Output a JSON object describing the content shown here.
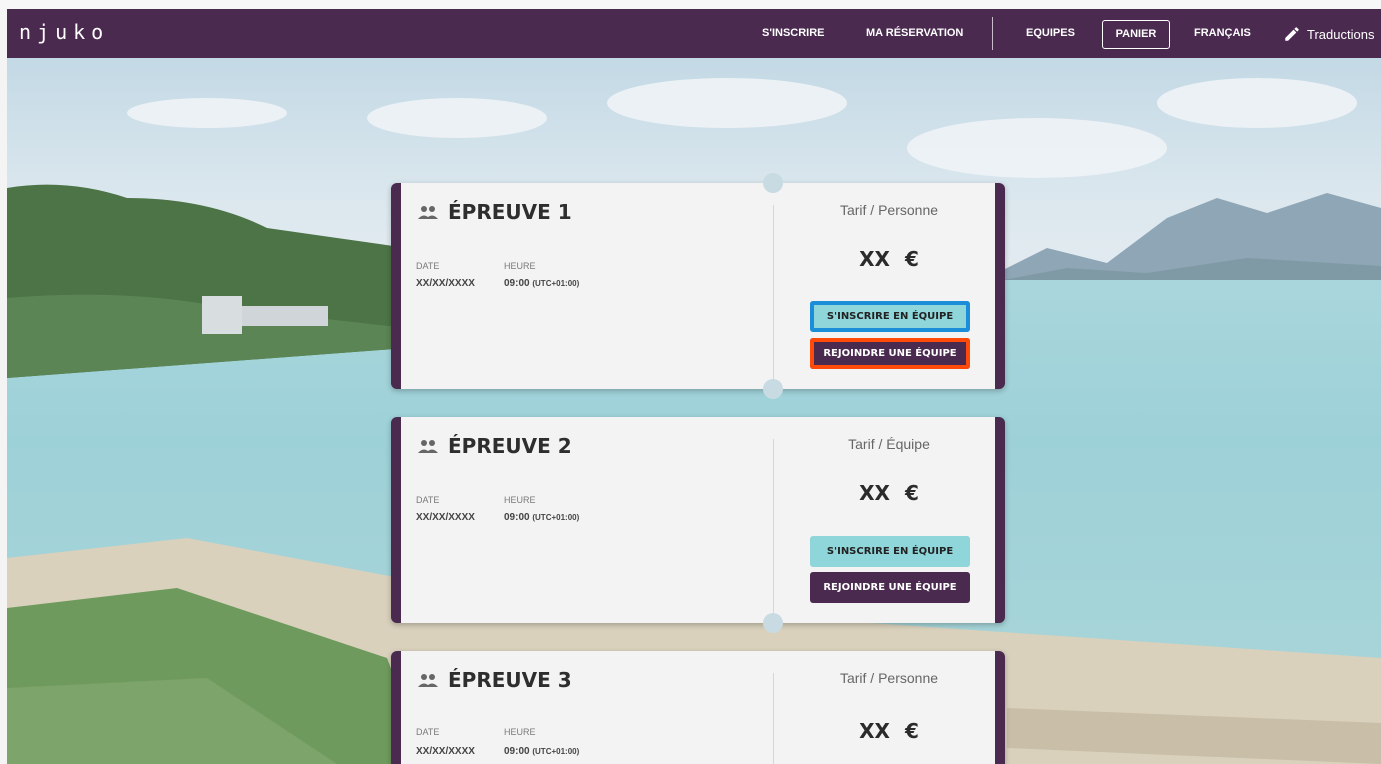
{
  "app": {
    "logo": "njuko"
  },
  "nav": {
    "register": "S'INSCRIRE",
    "my_booking": "MA RÉSERVATION",
    "teams": "EQUIPES",
    "cart": "PANIER",
    "language": "FRANÇAIS",
    "translations": "Traductions",
    "translations_icon": "pencil-icon"
  },
  "colors": {
    "brand": "#4a2a4f",
    "join_button": "#8fd6da",
    "highlight_blue": "#1a8ed8",
    "highlight_orange": "#ff4a0a"
  },
  "events": [
    {
      "icon": "group-icon",
      "title": "ÉPREUVE 1",
      "date_label": "DATE",
      "date_value": "XX/XX/XXXX",
      "time_label": "HEURE",
      "time_value": "09:00",
      "timezone": "(UTC+01:00)",
      "price_label": "Tarif / Personne",
      "price": "XX €",
      "join_team_label": "S'INSCRIRE EN ÉQUIPE",
      "join_existing_label": "REJOINDRE UNE ÉQUIPE"
    },
    {
      "icon": "group-icon",
      "title": "ÉPREUVE 2",
      "date_label": "DATE",
      "date_value": "XX/XX/XXXX",
      "time_label": "HEURE",
      "time_value": "09:00",
      "timezone": "(UTC+01:00)",
      "price_label": "Tarif / Équipe",
      "price": "XX €",
      "join_team_label": "S'INSCRIRE EN ÉQUIPE",
      "join_existing_label": "REJOINDRE UNE ÉQUIPE"
    },
    {
      "icon": "group-icon",
      "title": "ÉPREUVE 3",
      "date_label": "DATE",
      "date_value": "XX/XX/XXXX",
      "time_label": "HEURE",
      "time_value": "09:00",
      "timezone": "(UTC+01:00)",
      "price_label": "Tarif / Personne",
      "price": "XX €"
    }
  ]
}
